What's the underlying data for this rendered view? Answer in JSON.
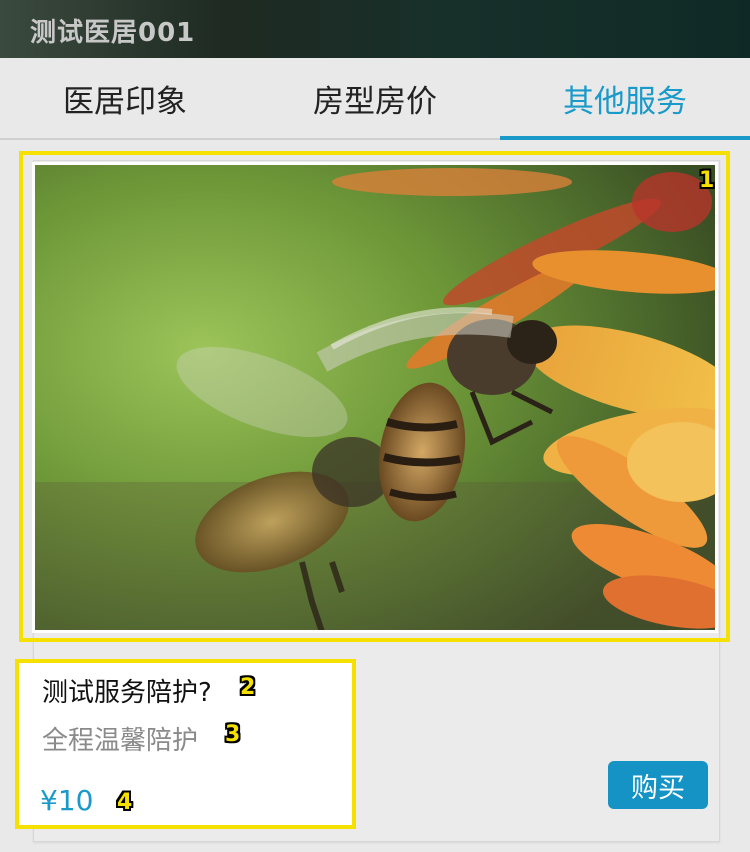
{
  "header": {
    "title": "测试医居001"
  },
  "tabs": [
    {
      "label": "医居印象",
      "active": false
    },
    {
      "label": "房型房价",
      "active": false
    },
    {
      "label": "其他服务",
      "active": true
    }
  ],
  "service": {
    "image_alt": "bees on orange flowers",
    "title": "测试服务陪护?",
    "subtitle": "全程温馨陪护",
    "price": "¥10",
    "buy_label": "购买"
  },
  "annotations": {
    "badge_1": "1",
    "badge_2": "2",
    "badge_3": "3",
    "badge_4": "4"
  },
  "colors": {
    "accent": "#1a9ac9",
    "highlight": "#f5e000"
  }
}
